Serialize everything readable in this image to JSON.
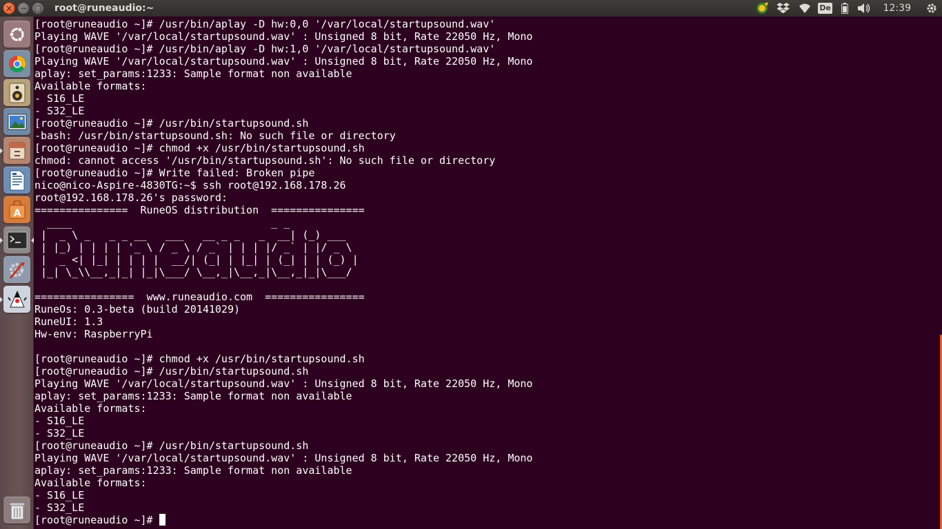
{
  "window": {
    "title": "root@runeaudio:~",
    "buttons": {
      "close": "×",
      "minimize": "−",
      "maximize": "□"
    }
  },
  "panel": {
    "keyboard_layout": "De",
    "clock": "12:39",
    "indicators": [
      "java-update-icon",
      "dropbox-icon",
      "wifi-icon",
      "keyboard-layout",
      "battery-icon",
      "volume-icon",
      "clock",
      "gear-icon"
    ]
  },
  "launcher": {
    "items": [
      "ubuntu-dash",
      "chrome-browser",
      "rhythmbox",
      "image-viewer",
      "file-manager",
      "libreoffice-writer",
      "software-center",
      "terminal",
      "system-settings",
      "java-app",
      "trash"
    ]
  },
  "terminal": {
    "prompt_last": "[root@runeaudio ~]# ",
    "lines": [
      "[root@runeaudio ~]# /usr/bin/aplay -D hw:0,0 '/var/local/startupsound.wav'",
      "Playing WAVE '/var/local/startupsound.wav' : Unsigned 8 bit, Rate 22050 Hz, Mono",
      "[root@runeaudio ~]# /usr/bin/aplay -D hw:1,0 '/var/local/startupsound.wav'",
      "Playing WAVE '/var/local/startupsound.wav' : Unsigned 8 bit, Rate 22050 Hz, Mono",
      "aplay: set_params:1233: Sample format non available",
      "Available formats:",
      "- S16_LE",
      "- S32_LE",
      "[root@runeaudio ~]# /usr/bin/startupsound.sh",
      "-bash: /usr/bin/startupsound.sh: No such file or directory",
      "[root@runeaudio ~]# chmod +x /usr/bin/startupsound.sh",
      "chmod: cannot access '/usr/bin/startupsound.sh': No such file or directory",
      "[root@runeaudio ~]# Write failed: Broken pipe",
      "nico@nico-Aspire-4830TG:~$ ssh root@192.168.178.26",
      "root@192.168.178.26's password:",
      "===============  RuneOS distribution  ===============",
      "  ____                                _ _",
      " |  _ \\ _   _ _ __   ___   __ _ _   _  __| (_) ___",
      " | |_) | | | | '_ \\ / _ \\ / _` | | | |/ _` | |/ _ \\",
      " |  _ <| |_| | | | |  __/| (_| | |_| | (_| | | (_) |",
      " |_| \\_\\\\__,_|_| |_|\\___/ \\__,_|\\__,_|\\__,_|_|\\___/",
      "",
      "================  www.runeaudio.com  ================",
      "RuneOs: 0.3-beta (build 20141029)",
      "RuneUI: 1.3",
      "Hw-env: RaspberryPi",
      "",
      "[root@runeaudio ~]# chmod +x /usr/bin/startupsound.sh",
      "[root@runeaudio ~]# /usr/bin/startupsound.sh",
      "Playing WAVE '/var/local/startupsound.wav' : Unsigned 8 bit, Rate 22050 Hz, Mono",
      "aplay: set_params:1233: Sample format non available",
      "Available formats:",
      "- S16_LE",
      "- S32_LE",
      "[root@runeaudio ~]# /usr/bin/startupsound.sh",
      "Playing WAVE '/var/local/startupsound.wav' : Unsigned 8 bit, Rate 22050 Hz, Mono",
      "aplay: set_params:1233: Sample format non available",
      "Available formats:",
      "- S16_LE",
      "- S32_LE"
    ]
  },
  "colors": {
    "terminal_bg": "#2c001e",
    "panel_bg": "#3c3b37",
    "accent": "#ec5a1e"
  }
}
